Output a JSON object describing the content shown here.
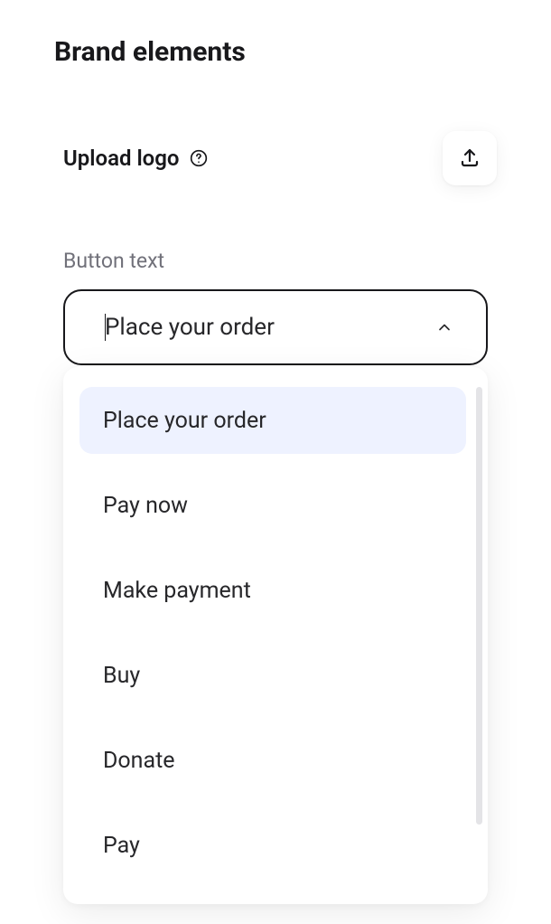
{
  "section": {
    "title": "Brand elements"
  },
  "upload": {
    "label": "Upload logo"
  },
  "buttonText": {
    "label": "Button text",
    "selected": "Place your order",
    "options": [
      "Place your order",
      "Pay now",
      "Make payment",
      "Buy",
      "Donate",
      "Pay"
    ]
  }
}
